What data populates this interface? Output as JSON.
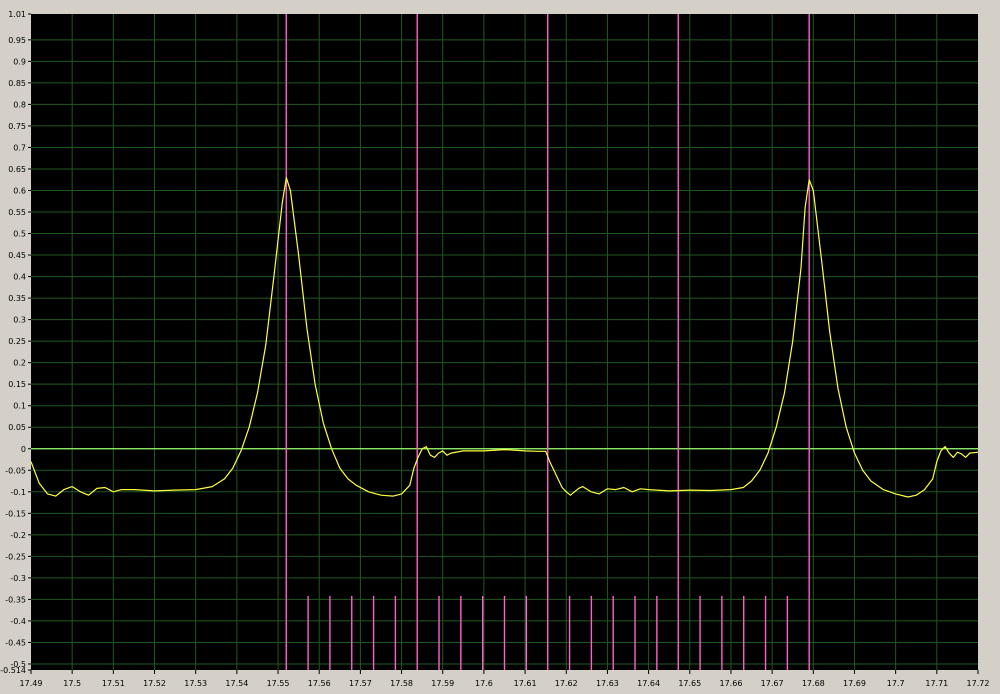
{
  "colors": {
    "background": "#000000",
    "frame": "#d4d0c8",
    "grid": "#1f5a1f",
    "trace": "#ffff40",
    "zero_line": "#9cff70",
    "markers": "#ff5fcf",
    "ticks_text": "#000000"
  },
  "chart_data": {
    "type": "line",
    "title": "",
    "xlabel": "",
    "ylabel": "",
    "xlim": [
      17.49,
      17.72
    ],
    "ylim": [
      -0.514,
      1.01
    ],
    "grid": true,
    "legend": "none",
    "x_ticks": [
      "17.49",
      "17.5",
      "17.51",
      "17.52",
      "17.53",
      "17.54",
      "17.55",
      "17.56",
      "17.57",
      "17.58",
      "17.59",
      "17.6",
      "17.61",
      "17.62",
      "17.63",
      "17.64",
      "17.65",
      "17.66",
      "17.67",
      "17.68",
      "17.69",
      "17.7",
      "17.71",
      "17.72"
    ],
    "y_ticks": [
      "-0.514",
      "-0.5",
      "-0.45",
      "-0.4",
      "-0.35",
      "-0.3",
      "-0.25",
      "-0.2",
      "-0.15",
      "-0.1",
      "-0.05",
      "0",
      "0.05",
      "0.1",
      "0.15",
      "0.2",
      "0.25",
      "0.3",
      "0.35",
      "0.4",
      "0.45",
      "0.5",
      "0.55",
      "0.6",
      "0.65",
      "0.7",
      "0.75",
      "0.8",
      "0.85",
      "0.9",
      "0.95",
      "1.01"
    ],
    "series": [
      {
        "points": [
          [
            17.49,
            -0.03
          ],
          [
            17.492,
            -0.08
          ],
          [
            17.494,
            -0.105
          ],
          [
            17.496,
            -0.11
          ],
          [
            17.498,
            -0.095
          ],
          [
            17.5,
            -0.088
          ],
          [
            17.502,
            -0.1
          ],
          [
            17.504,
            -0.108
          ],
          [
            17.506,
            -0.092
          ],
          [
            17.508,
            -0.09
          ],
          [
            17.51,
            -0.1
          ],
          [
            17.512,
            -0.095
          ],
          [
            17.515,
            -0.095
          ],
          [
            17.52,
            -0.098
          ],
          [
            17.525,
            -0.096
          ],
          [
            17.53,
            -0.095
          ],
          [
            17.534,
            -0.088
          ],
          [
            17.537,
            -0.07
          ],
          [
            17.539,
            -0.045
          ],
          [
            17.541,
            -0.005
          ],
          [
            17.543,
            0.05
          ],
          [
            17.545,
            0.13
          ],
          [
            17.547,
            0.24
          ],
          [
            17.549,
            0.4
          ],
          [
            17.551,
            0.57
          ],
          [
            17.552,
            0.63
          ],
          [
            17.553,
            0.6
          ],
          [
            17.555,
            0.45
          ],
          [
            17.557,
            0.28
          ],
          [
            17.559,
            0.15
          ],
          [
            17.561,
            0.06
          ],
          [
            17.563,
            0.0
          ],
          [
            17.565,
            -0.045
          ],
          [
            17.567,
            -0.07
          ],
          [
            17.569,
            -0.085
          ],
          [
            17.572,
            -0.1
          ],
          [
            17.575,
            -0.108
          ],
          [
            17.578,
            -0.11
          ],
          [
            17.58,
            -0.105
          ],
          [
            17.582,
            -0.085
          ],
          [
            17.583,
            -0.045
          ],
          [
            17.584,
            -0.02
          ],
          [
            17.585,
            0.0
          ],
          [
            17.586,
            0.005
          ],
          [
            17.587,
            -0.015
          ],
          [
            17.588,
            -0.02
          ],
          [
            17.589,
            -0.01
          ],
          [
            17.59,
            -0.005
          ],
          [
            17.591,
            -0.015
          ],
          [
            17.592,
            -0.01
          ],
          [
            17.595,
            -0.005
          ],
          [
            17.6,
            -0.005
          ],
          [
            17.605,
            -0.002
          ],
          [
            17.61,
            -0.005
          ],
          [
            17.613,
            -0.006
          ],
          [
            17.615,
            -0.006
          ],
          [
            17.616,
            -0.03
          ],
          [
            17.618,
            -0.07
          ],
          [
            17.619,
            -0.09
          ],
          [
            17.62,
            -0.1
          ],
          [
            17.621,
            -0.108
          ],
          [
            17.623,
            -0.092
          ],
          [
            17.624,
            -0.088
          ],
          [
            17.626,
            -0.1
          ],
          [
            17.628,
            -0.105
          ],
          [
            17.63,
            -0.093
          ],
          [
            17.632,
            -0.095
          ],
          [
            17.634,
            -0.09
          ],
          [
            17.636,
            -0.1
          ],
          [
            17.638,
            -0.093
          ],
          [
            17.64,
            -0.095
          ],
          [
            17.645,
            -0.098
          ],
          [
            17.65,
            -0.096
          ],
          [
            17.655,
            -0.097
          ],
          [
            17.66,
            -0.095
          ],
          [
            17.663,
            -0.09
          ],
          [
            17.665,
            -0.075
          ],
          [
            17.667,
            -0.05
          ],
          [
            17.669,
            -0.01
          ],
          [
            17.671,
            0.05
          ],
          [
            17.673,
            0.13
          ],
          [
            17.675,
            0.25
          ],
          [
            17.677,
            0.42
          ],
          [
            17.678,
            0.56
          ],
          [
            17.679,
            0.625
          ],
          [
            17.68,
            0.6
          ],
          [
            17.682,
            0.44
          ],
          [
            17.684,
            0.27
          ],
          [
            17.686,
            0.14
          ],
          [
            17.688,
            0.05
          ],
          [
            17.69,
            -0.01
          ],
          [
            17.692,
            -0.05
          ],
          [
            17.694,
            -0.075
          ],
          [
            17.697,
            -0.095
          ],
          [
            17.7,
            -0.105
          ],
          [
            17.703,
            -0.112
          ],
          [
            17.705,
            -0.108
          ],
          [
            17.707,
            -0.095
          ],
          [
            17.709,
            -0.07
          ],
          [
            17.71,
            -0.03
          ],
          [
            17.711,
            -0.005
          ],
          [
            17.712,
            0.005
          ],
          [
            17.713,
            -0.01
          ],
          [
            17.714,
            -0.02
          ],
          [
            17.715,
            -0.008
          ],
          [
            17.716,
            -0.012
          ],
          [
            17.717,
            -0.02
          ],
          [
            17.718,
            -0.01
          ],
          [
            17.72,
            -0.008
          ]
        ]
      }
    ],
    "marker_lines_x": [
      17.552,
      17.5838,
      17.6155,
      17.6472,
      17.679
    ],
    "short_markers": {
      "x": [
        17.5573,
        17.5626,
        17.5679,
        17.5732,
        17.5785,
        17.5891,
        17.5944,
        17.5997,
        17.605,
        17.6103,
        17.6208,
        17.6261,
        17.6314,
        17.6367,
        17.642,
        17.6525,
        17.6578,
        17.6631,
        17.6684,
        17.6737
      ],
      "top_y": -0.342,
      "bottom_y": -0.514
    }
  }
}
